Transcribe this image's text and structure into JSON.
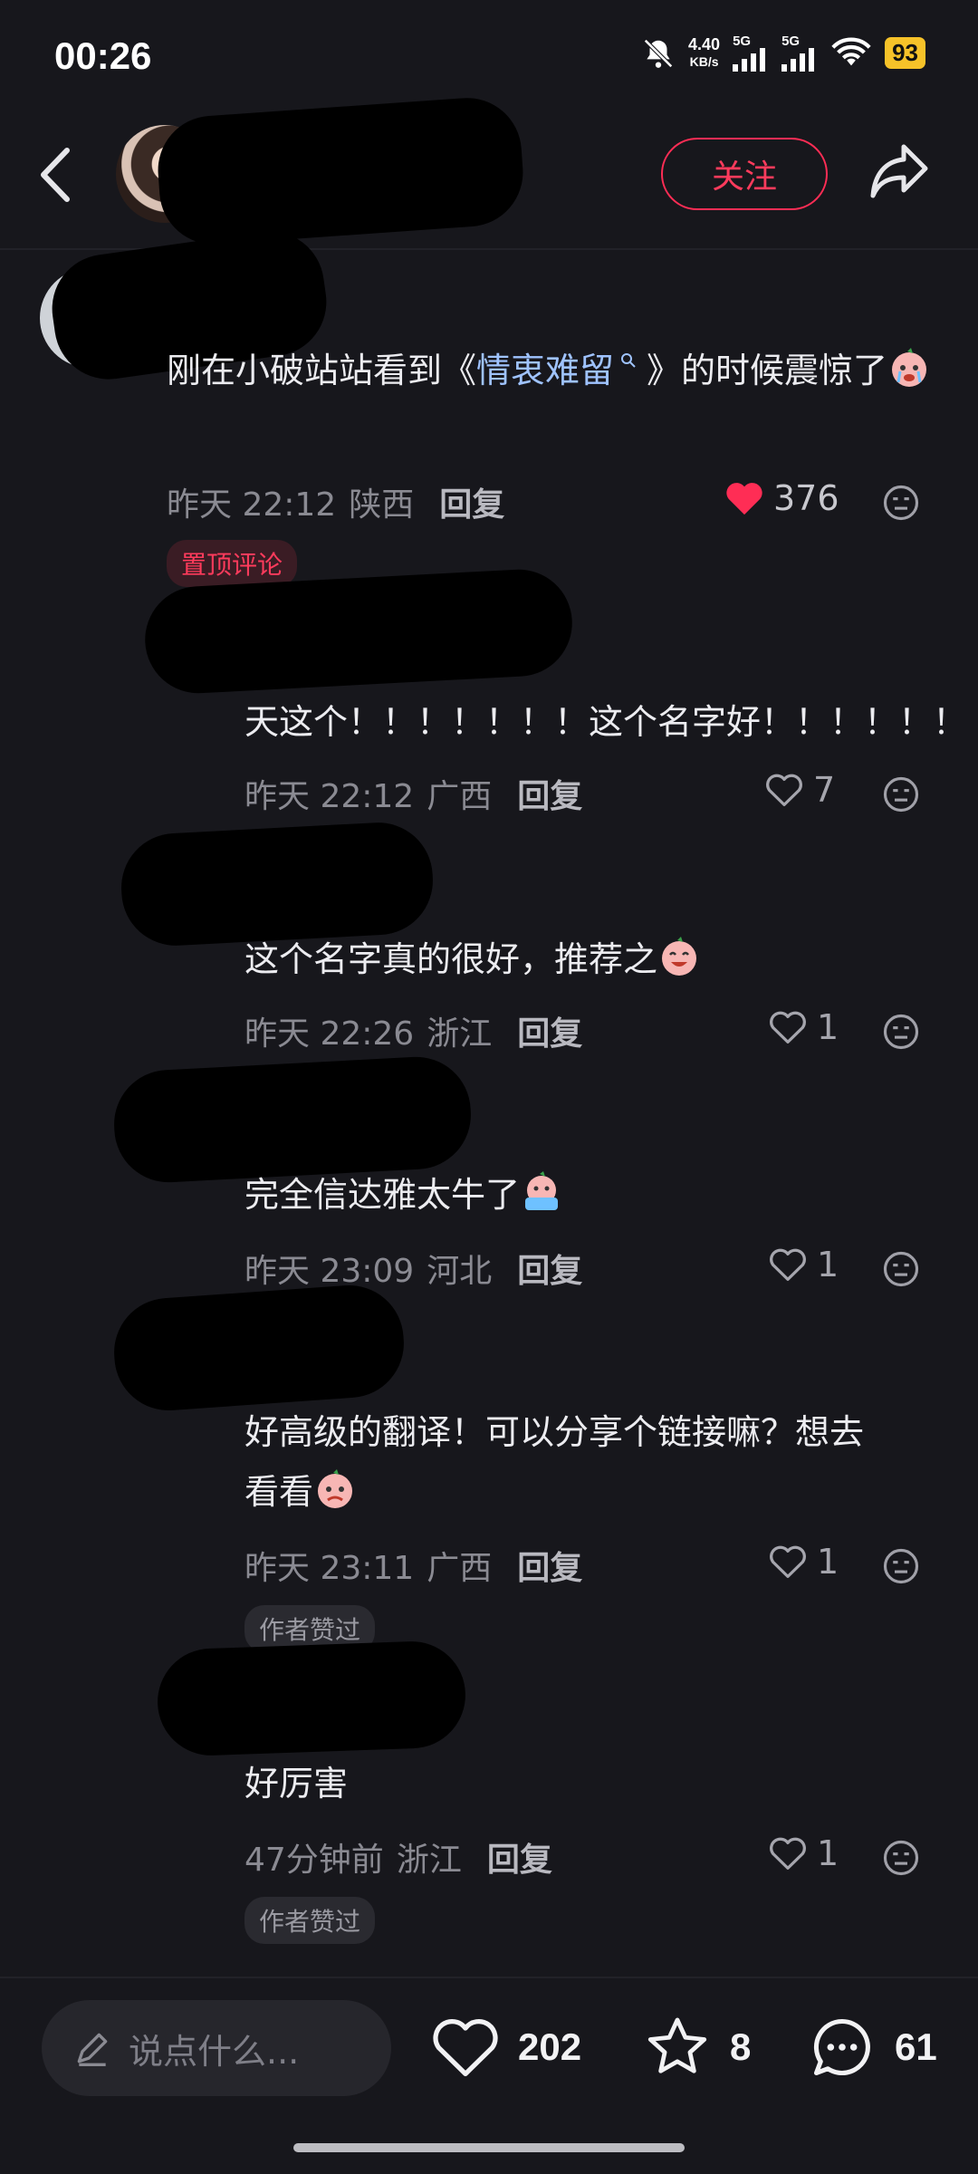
{
  "status_bar": {
    "time": "00:26",
    "net_speed_value": "4.40",
    "net_speed_unit": "KB/s",
    "sim1": "5G",
    "sim2": "5G",
    "battery": "93"
  },
  "header": {
    "follow_label": "关注"
  },
  "comments": [
    {
      "text_before": "刚在小破站站看到《",
      "keyword": "情衷难留",
      "text_after": "》的时候震惊了",
      "time": "昨天 22:12",
      "location": "陕西",
      "reply_label": "回复",
      "likes": "376",
      "tag": "置顶评论"
    },
    {
      "text": "天这个！！！！！！！这个名字好！！！！！！",
      "time": "昨天 22:12",
      "location": "广西",
      "reply_label": "回复",
      "likes": "7"
    },
    {
      "text": "这个名字真的很好，推荐之",
      "time": "昨天 22:26",
      "location": "浙江",
      "reply_label": "回复",
      "likes": "1"
    },
    {
      "text": "完全信达雅太牛了",
      "time": "昨天 23:09",
      "location": "河北",
      "reply_label": "回复",
      "likes": "1"
    },
    {
      "text_line1": "好高级的翻译！可以分享个链接嘛？想去",
      "text_line2": "看看",
      "time": "昨天 23:11",
      "location": "广西",
      "reply_label": "回复",
      "likes": "1",
      "tag": "作者赞过"
    },
    {
      "text": "好厉害",
      "time": "47分钟前",
      "location": "浙江",
      "reply_label": "回复",
      "likes": "1",
      "tag": "作者赞过"
    }
  ],
  "bottom_bar": {
    "input_placeholder": "说点什么...",
    "likes": "202",
    "favorites": "8",
    "comments": "61"
  },
  "colors": {
    "background": "#17171c",
    "accent_red": "#ff2d55",
    "link_blue": "#9fc3ff"
  },
  "icons": [
    "back-arrow-icon",
    "share-icon",
    "heart-icon",
    "dislike-icon",
    "pencil-icon",
    "star-icon",
    "comment-icon",
    "mute-bell-icon",
    "wifi-icon",
    "signal-icon"
  ]
}
